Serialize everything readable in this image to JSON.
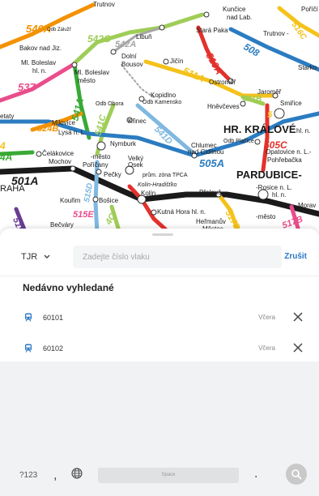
{
  "map": {
    "stations": {
      "trutnov_top": "Trutnov",
      "kuncice": "Kunčice",
      "kuncice_sub": "nad Lab.",
      "porici": "Poříčí",
      "bakov": "Bakov nad Jiz.",
      "libun": "Libuň",
      "stara_paka": "Stará Paka",
      "trutnov_hl": "Trutnov -",
      "dolni_bousov_1": "Dolní",
      "dolni_bousov_2": "Bousov",
      "jicin": "Jičín",
      "ml_boleslav_hl_1": "Ml. Boleslav",
      "ml_boleslav_hl_2": "hl. n.",
      "ml_boleslav_m_1": "Ml. Boleslav",
      "ml_boleslav_m_2": "město",
      "starkoc": "Starko",
      "ostromer": "Ostroměř",
      "jaromer": "Jaroměř",
      "kopidlno": "Kopidlno",
      "odb_kamensko": "Odb Kamensko",
      "odb_obora": "Odb Obora",
      "hnevceves": "Hněvčeves",
      "smirice": "Smiřice",
      "stety": "etaty",
      "milovice": "Milovice",
      "lysa": "Lysá n. L.",
      "krinec": "Křinec",
      "hr_kralove": "HR. KRÁLOVÉ",
      "hr_kralove_hl": "hl. n.",
      "odb_placice": "Odb Plačice",
      "opatovice": "Opatovice n. L.-",
      "pohranacka": "Pohřebačka",
      "celakovice": "Čelákovice",
      "mochov": "Mochov",
      "mesto": "-město",
      "nymburk": "Nymburk",
      "chlumec_1": "Chlumec",
      "chlumec_2": "nad Cidlinou",
      "porican": "Poříčany",
      "pecky": "Pečky",
      "velky_osek_1": "Velký",
      "velky_osek_2": "Osek",
      "prum_zona": "prům. zóna TPCA",
      "pardubice": "PARDUBICE-",
      "rosice": "-Rosice n. L.",
      "rosice_hl": "hl. n.",
      "praha": "RAHA",
      "kolin_hradistko": "Kolín-Hradišťko",
      "kolin": "Kolín",
      "prelouc": "Přelouč",
      "morav": "Morav",
      "kourim": "Kouřim",
      "bosice": "Bošice",
      "kutna_hora": "Kutná Hora hl. n.",
      "hermanuv_1": "Heřmanův",
      "hermanuv_2": "Městec",
      "mesto_2": "-město",
      "becvary": "Bečváry",
      "odb_zaluzi": "Odb Zálužř"
    },
    "lines": {
      "l540a": "540A",
      "l542c": "542C",
      "l542a": "542A",
      "l510a": "510A",
      "l508": "508",
      "l537": "537",
      "l511a": "511A",
      "l541a": "541A",
      "l511b": "511B",
      "l524b": "524B",
      "l541d": "541D",
      "l541c": "541C",
      "l505a": "505A",
      "l505c": "505C",
      "l501a": "501A",
      "l515d": "515D",
      "l515e": "515E",
      "l517d": "517D",
      "l517b": "517B",
      "l519": "519",
      "l4a": "4A",
      "l516c": "516C",
      "l4c": "4C",
      "l4": "4",
      "l5s": "5"
    },
    "colors": {
      "red": "#e3312b",
      "green": "#39a935",
      "lightgreen": "#9fcd57",
      "blue": "#2b7cc1",
      "lightblue": "#7fb8e0",
      "yellow": "#f5c21b",
      "pink": "#ea4d8c",
      "purple": "#6a3c91",
      "orange": "#f39200",
      "black": "#1a1a1a",
      "grey": "#a6a6a6"
    }
  },
  "search": {
    "train_type": "TJR",
    "placeholder": "Zadejte číslo vlaku",
    "cancel_label": "Zrušit"
  },
  "recent": {
    "title": "Nedávno vyhledané",
    "items": [
      {
        "number": "60101",
        "when": "Včera"
      },
      {
        "number": "60102",
        "when": "Včera"
      }
    ]
  },
  "keyboard": {
    "num_key": "?123",
    "comma": ",",
    "space_label": "Space",
    "period": "."
  },
  "colors": {
    "accent": "#2b78c5",
    "train_icon": "#2b78c5"
  }
}
